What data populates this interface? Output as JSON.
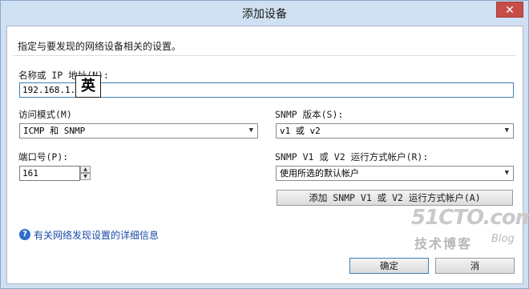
{
  "window": {
    "title": "添加设备",
    "close_glyph": "✕"
  },
  "description": "指定与要发现的网络设备相关的设置。",
  "name_ip": {
    "label": "名称或 IP 地址(N):",
    "value": "192.168.1.2"
  },
  "access_mode": {
    "label": "访问模式(M)",
    "selected": "ICMP 和 SNMP"
  },
  "ime_indicator": "英",
  "snmp_version": {
    "label": "SNMP 版本(S):",
    "selected": "v1 或 v2"
  },
  "port": {
    "label": "端口号(P):",
    "value": "161"
  },
  "snmp_account": {
    "label": "SNMP V1 或 V2 运行方式帐户(R):",
    "selected": "使用所选的默认帐户"
  },
  "add_account_button": "添加 SNMP V1 或 V2 运行方式帐户(A)",
  "help": {
    "icon": "help-icon",
    "link_text": "有关网络发现设置的详细信息"
  },
  "footer": {
    "ok_label": "确定",
    "cancel_label": "消"
  },
  "watermark": {
    "logo": "51CTO.com",
    "sub": "技术博客",
    "blog": "Blog"
  },
  "colors": {
    "titlebar_bg": "#cfe0f2",
    "close_button": "#c74e48",
    "link": "#1a4aa8",
    "focus_border": "#3c7fb1"
  }
}
